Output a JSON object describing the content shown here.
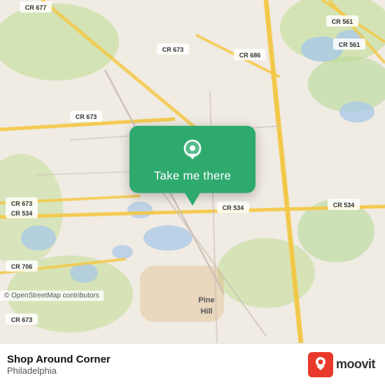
{
  "map": {
    "copyright": "© OpenStreetMap contributors",
    "background_color": "#e8e0d8"
  },
  "popup": {
    "button_label": "Take me there",
    "icon": "location-pin"
  },
  "bottom_bar": {
    "place_name": "Shop Around Corner",
    "place_city": "Philadelphia",
    "moovit_label": "moovit",
    "copyright": "© OpenStreetMap contributors"
  }
}
